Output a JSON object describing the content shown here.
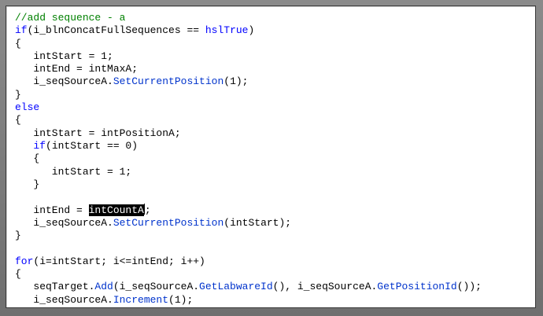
{
  "editor": {
    "lines": [
      [
        {
          "t": "//add sequence - a",
          "c": "cm"
        }
      ],
      [
        {
          "t": "if",
          "c": "kw"
        },
        {
          "t": "(i_blnConcatFullSequences == "
        },
        {
          "t": "hslTrue",
          "c": "kw"
        },
        {
          "t": ")"
        }
      ],
      [
        {
          "t": "{"
        }
      ],
      [
        {
          "t": "   intStart = 1;"
        }
      ],
      [
        {
          "t": "   intEnd = intMaxA;"
        }
      ],
      [
        {
          "t": "   i_seqSourceA."
        },
        {
          "t": "SetCurrentPosition",
          "c": "fn"
        },
        {
          "t": "(1);"
        }
      ],
      [
        {
          "t": "}"
        }
      ],
      [
        {
          "t": "else",
          "c": "kw"
        }
      ],
      [
        {
          "t": "{"
        }
      ],
      [
        {
          "t": "   intStart = intPositionA;"
        }
      ],
      [
        {
          "t": "   "
        },
        {
          "t": "if",
          "c": "kw"
        },
        {
          "t": "(intStart == 0)"
        }
      ],
      [
        {
          "t": "   {"
        }
      ],
      [
        {
          "t": "      intStart = 1;"
        }
      ],
      [
        {
          "t": "   }"
        }
      ],
      [
        {
          "t": ""
        }
      ],
      [
        {
          "t": "   intEnd = "
        },
        {
          "t": "intCountA",
          "c": "sel"
        },
        {
          "t": ";"
        }
      ],
      [
        {
          "t": "   i_seqSourceA."
        },
        {
          "t": "SetCurrentPosition",
          "c": "fn"
        },
        {
          "t": "(intStart);"
        }
      ],
      [
        {
          "t": "}"
        }
      ],
      [
        {
          "t": ""
        }
      ],
      [
        {
          "t": "for",
          "c": "kw"
        },
        {
          "t": "(i=intStart; i<=intEnd; i++)"
        }
      ],
      [
        {
          "t": "{"
        }
      ],
      [
        {
          "t": "   seqTarget."
        },
        {
          "t": "Add",
          "c": "fn"
        },
        {
          "t": "(i_seqSourceA."
        },
        {
          "t": "GetLabwareId",
          "c": "fn"
        },
        {
          "t": "(), i_seqSourceA."
        },
        {
          "t": "GetPositionId",
          "c": "fn"
        },
        {
          "t": "());"
        }
      ],
      [
        {
          "t": "   i_seqSourceA."
        },
        {
          "t": "Increment",
          "c": "fn"
        },
        {
          "t": "(1);"
        }
      ],
      [
        {
          "t": "}"
        }
      ]
    ]
  }
}
